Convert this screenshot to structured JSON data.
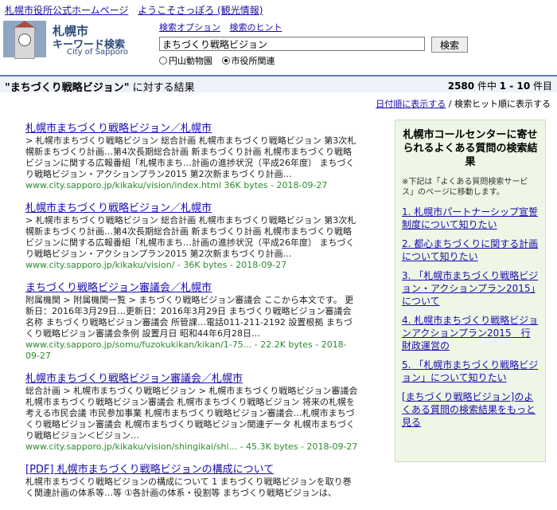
{
  "top_links": [
    "札幌市役所公式ホームページ",
    "ようこそさっぽろ (観光情報)"
  ],
  "logo": {
    "line1": "札幌市",
    "line2": "キーワード検索",
    "line3": "City of Sapporo"
  },
  "search": {
    "options": [
      "検索オプション",
      "検索のヒント"
    ],
    "query": "まちづくり戦略ビジョン",
    "button": "検索",
    "radios": [
      {
        "label": "円山動物園",
        "checked": false
      },
      {
        "label": "市役所関連",
        "checked": true
      }
    ]
  },
  "result_header": {
    "query_quoted": "\"まちづくり戦略ビジョン\"",
    "suffix": " に対する結果",
    "count": "2580",
    "count_suffix": " 件中 ",
    "range": "1 - 10",
    "range_suffix": " 件目"
  },
  "sort": {
    "link": "日付順に表示する",
    "current": " / 検索ヒット順に表示する"
  },
  "results": [
    {
      "title": "札幌市まちづくり戦略ビジョン／札幌市",
      "snippet": "> 札幌市まちづくり戦略ビジョン 総合計画 札幌市まちづくり戦略ビジョン 第3次札幌新まちづくり計画…第4次長期総合計画 新まちづくり計画 札幌市まちづくり戦略ビジョンに関する広報番組「札幌市まち…計画の進捗状況（平成26年度） まちづくり戦略ビジョン・アクションプラン2015 第2次新まちづくり計画…",
      "url": "www.city.sapporo.jp/kikaku/vision/index.html 36K bytes - 2018-09-27"
    },
    {
      "title": "札幌市まちづくり戦略ビジョン／札幌市",
      "snippet": "> 札幌市まちづくり戦略ビジョン 総合計画 札幌市まちづくり戦略ビジョン 第3次札幌新まちづくり計画…第4次長期総合計画 新まちづくり計画 札幌市まちづくり戦略ビジョンに関する広報番組「札幌市まち…計画の進捗状況（平成26年度） まちづくり戦略ビジョン・アクションプラン2015 第2次新まちづくり計画…",
      "url": "www.city.sapporo.jp/kikaku/vision/ - 36K bytes - 2018-09-27"
    },
    {
      "title": "まちづくり戦略ビジョン審議会／札幌市",
      "snippet": "附属機関 > 附属機関一覧 > まちづくり戦略ビジョン審議会 ここから本文です。 更新日：2016年3月29日…更新日：2016年3月29日 まちづくり戦略ビジョン審議会 名称 まちづくり戦略ビジョン審議会 所管課…電話011-211-2192 設置根拠 まちづくり戦略ビジョン審議会条例 設置月日 昭和44年6月28日…",
      "url": "www.city.sapporo.jp/somu/fuzokukikan/kikan/1-75... - 22.2K bytes - 2018-09-27"
    },
    {
      "title": "札幌市まちづくり戦略ビジョン審議会／札幌市",
      "snippet": "総合計画 > 札幌市まちづくり戦略ビジョン > 札幌市まちづくり戦略ビジョン審議会 札幌市まちづくり戦略ビジョン審議会 札幌市まちづくり戦略ビジョン 将来の札幌を考える市民会議 市民参加事業 札幌市まちづくり戦略ビジョン審議会…札幌市まちづくり戦略ビジョン審議会 札幌市まちづくり戦略ビジョン関連データ 札幌市まちづくり戦略ビジョン＜ビジョン…",
      "url": "www.city.sapporo.jp/kikaku/vision/shingikai/shi... - 45.3K bytes - 2018-09-27"
    },
    {
      "title": "[PDF] 札幌市まちづくり戦略ビジョンの構成について",
      "snippet": "札幌市まちづくり戦略ビジョンの構成について 1 まちづくり戦略ビジョンを取り巻く関連計画の体系等…等 ①各計画の体系・役割等 まちづくり戦略ビジョンは、",
      "url": ""
    }
  ],
  "sidebar": {
    "title": "札幌市コールセンターに寄せられるよくある質問の検索結果",
    "note": "※下記は「よくある質問検索サービス」のページに移動します。",
    "links": [
      "1. 札幌市パートナーシップ宣誓制度について知りたい",
      "2. 都心まちづくりに関する計画について知りたい",
      "3. 「札幌市まちづくり戦略ビジョン・アクションプラン2015」について",
      "4. 札幌市まちづくり戦略ビジョンアクションプラン2015　行財政運営の",
      "5. 「札幌市まちづくり戦略ビジョン」について知りたい",
      "[まちづくり戦略ビジョン]のよくある質問の検索結果をもっと見る"
    ]
  }
}
